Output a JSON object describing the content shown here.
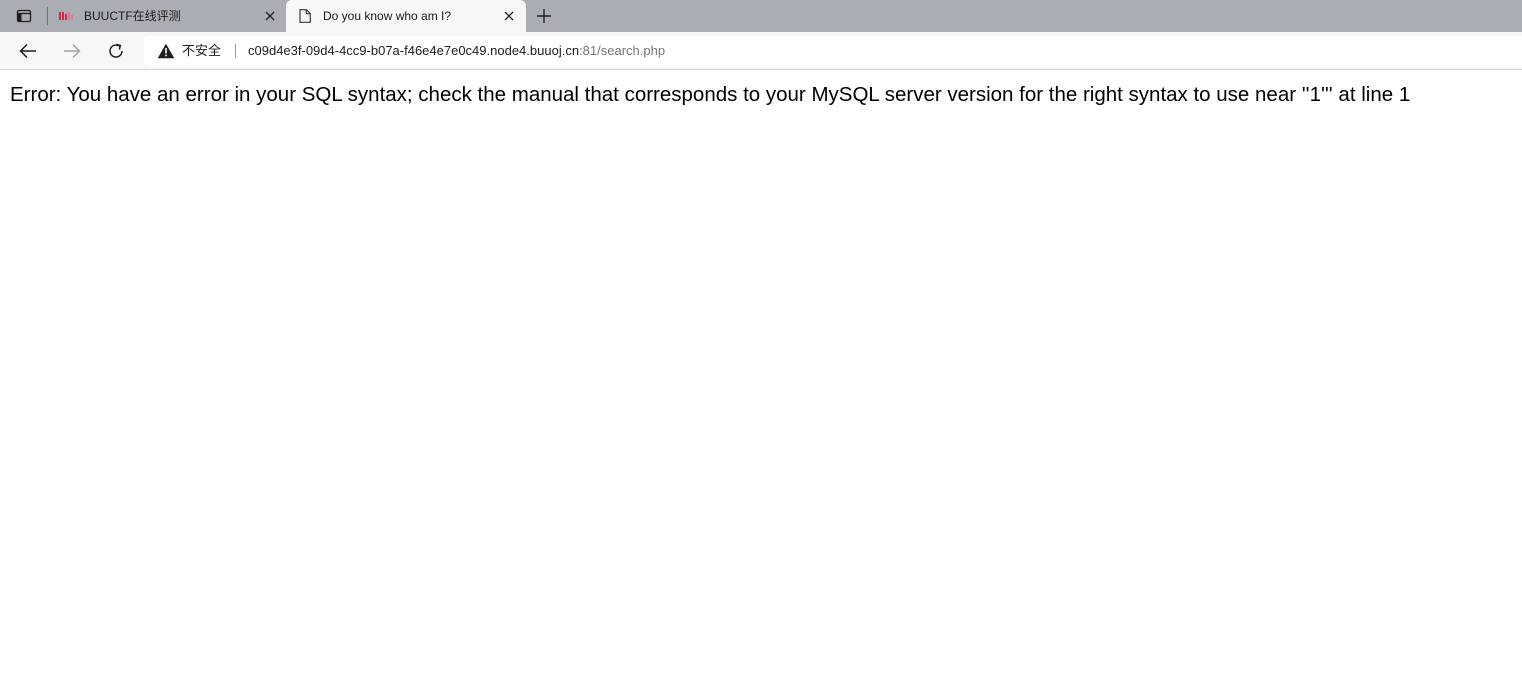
{
  "browser": {
    "tabs": [
      {
        "title": "BUUCTF在线评测",
        "favicon": "buuctf-favicon",
        "active": false
      },
      {
        "title": "Do you know who am I?",
        "favicon": "page-icon",
        "active": true
      }
    ],
    "toolbar": {
      "security_label": "不安全",
      "url_host": "c09d4e3f-09d4-4cc9-b07a-f46e4e7e0c49.node4.buuoj.cn",
      "url_rest": ":81/search.php"
    },
    "icons": {
      "tab_actions": "tab-actions-icon",
      "close": "close-icon",
      "new_tab": "plus-icon",
      "back": "back-arrow-icon",
      "forward": "forward-arrow-icon",
      "reload": "reload-icon",
      "security": "warning-icon"
    },
    "colors": {
      "tabstrip": "#aaadb4",
      "toolbar": "#f7f7f7",
      "favicon_red": "#d0284c"
    }
  },
  "page": {
    "error_message": "Error: You have an error in your SQL syntax; check the manual that corresponds to your MySQL server version for the right syntax to use near ''1''' at line 1"
  }
}
